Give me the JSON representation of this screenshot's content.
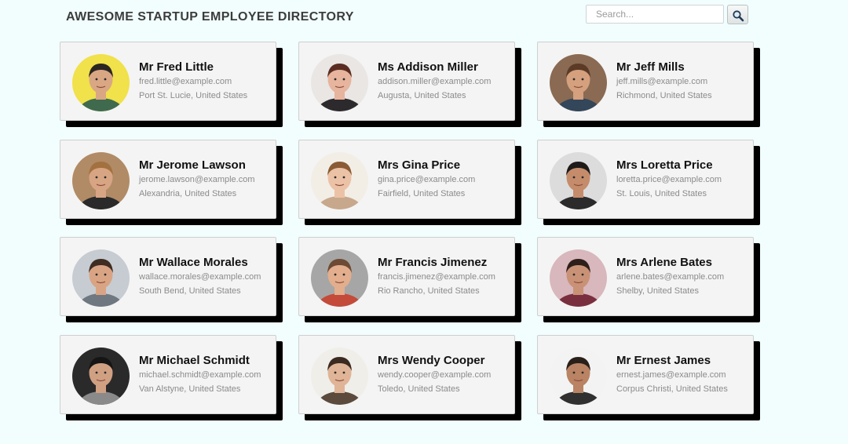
{
  "header": {
    "title": "AWESOME STARTUP EMPLOYEE DIRECTORY"
  },
  "search": {
    "placeholder": "Search..."
  },
  "icons": {
    "search_button": "magnifier-icon"
  },
  "employees": [
    {
      "name": "Mr Fred Little",
      "email": "fred.little@example.com",
      "location": "Port St. Lucie, United States",
      "bg": "#f1e14a",
      "skin": "#d9a784",
      "hair": "#2b2622",
      "shirt": "#3f6a4e"
    },
    {
      "name": "Ms Addison Miller",
      "email": "addison.miller@example.com",
      "location": "Augusta, United States",
      "bg": "#e9e6e4",
      "skin": "#e7b49d",
      "hair": "#5a2d22",
      "shirt": "#2d2a2e"
    },
    {
      "name": "Mr Jeff Mills",
      "email": "jeff.mills@example.com",
      "location": "Richmond, United States",
      "bg": "#8a6a52",
      "skin": "#d4a07e",
      "hair": "#5b3a26",
      "shirt": "#33465a"
    },
    {
      "name": "Mr Jerome Lawson",
      "email": "jerome.lawson@example.com",
      "location": "Alexandria, United States",
      "bg": "#b18b66",
      "skin": "#d7a583",
      "hair": "#a2713f",
      "shirt": "#2a2a2a"
    },
    {
      "name": "Mrs Gina Price",
      "email": "gina.price@example.com",
      "location": "Fairfield, United States",
      "bg": "#f2eee6",
      "skin": "#ecc2a6",
      "hair": "#8a5b34",
      "shirt": "#c7a88d"
    },
    {
      "name": "Mrs Loretta Price",
      "email": "loretta.price@example.com",
      "location": "St. Louis, United States",
      "bg": "#dcdcdc",
      "skin": "#c58c6b",
      "hair": "#1f1a1a",
      "shirt": "#2b2b2b"
    },
    {
      "name": "Mr Wallace Morales",
      "email": "wallace.morales@example.com",
      "location": "South Bend, United States",
      "bg": "#c7ccd2",
      "skin": "#d9a484",
      "hair": "#3e2d22",
      "shirt": "#6f7780"
    },
    {
      "name": "Mr Francis Jimenez",
      "email": "francis.jimenez@example.com",
      "location": "Rio Rancho, United States",
      "bg": "#a6a6a6",
      "skin": "#e2ae8d",
      "hair": "#6c4a33",
      "shirt": "#c44a3a"
    },
    {
      "name": "Mrs Arlene Bates",
      "email": "arlene.bates@example.com",
      "location": "Shelby, United States",
      "bg": "#d8b7bd",
      "skin": "#c99276",
      "hair": "#2e1f1a",
      "shirt": "#7a2f3f"
    },
    {
      "name": "Mr Michael Schmidt",
      "email": "michael.schmidt@example.com",
      "location": "Van Alstyne, United States",
      "bg": "#2a2a2a",
      "skin": "#d0a082",
      "hair": "#151515",
      "shirt": "#8a8a8a"
    },
    {
      "name": "Mrs Wendy Cooper",
      "email": "wendy.cooper@example.com",
      "location": "Toledo, United States",
      "bg": "#efeee9",
      "skin": "#e0b497",
      "hair": "#3a2a20",
      "shirt": "#5c4a3c"
    },
    {
      "name": "Mr Ernest James",
      "email": "ernest.james@example.com",
      "location": "Corpus Christi, United States",
      "bg": "#f3f3f3",
      "skin": "#b98364",
      "hair": "#2a201a",
      "shirt": "#303030"
    }
  ]
}
